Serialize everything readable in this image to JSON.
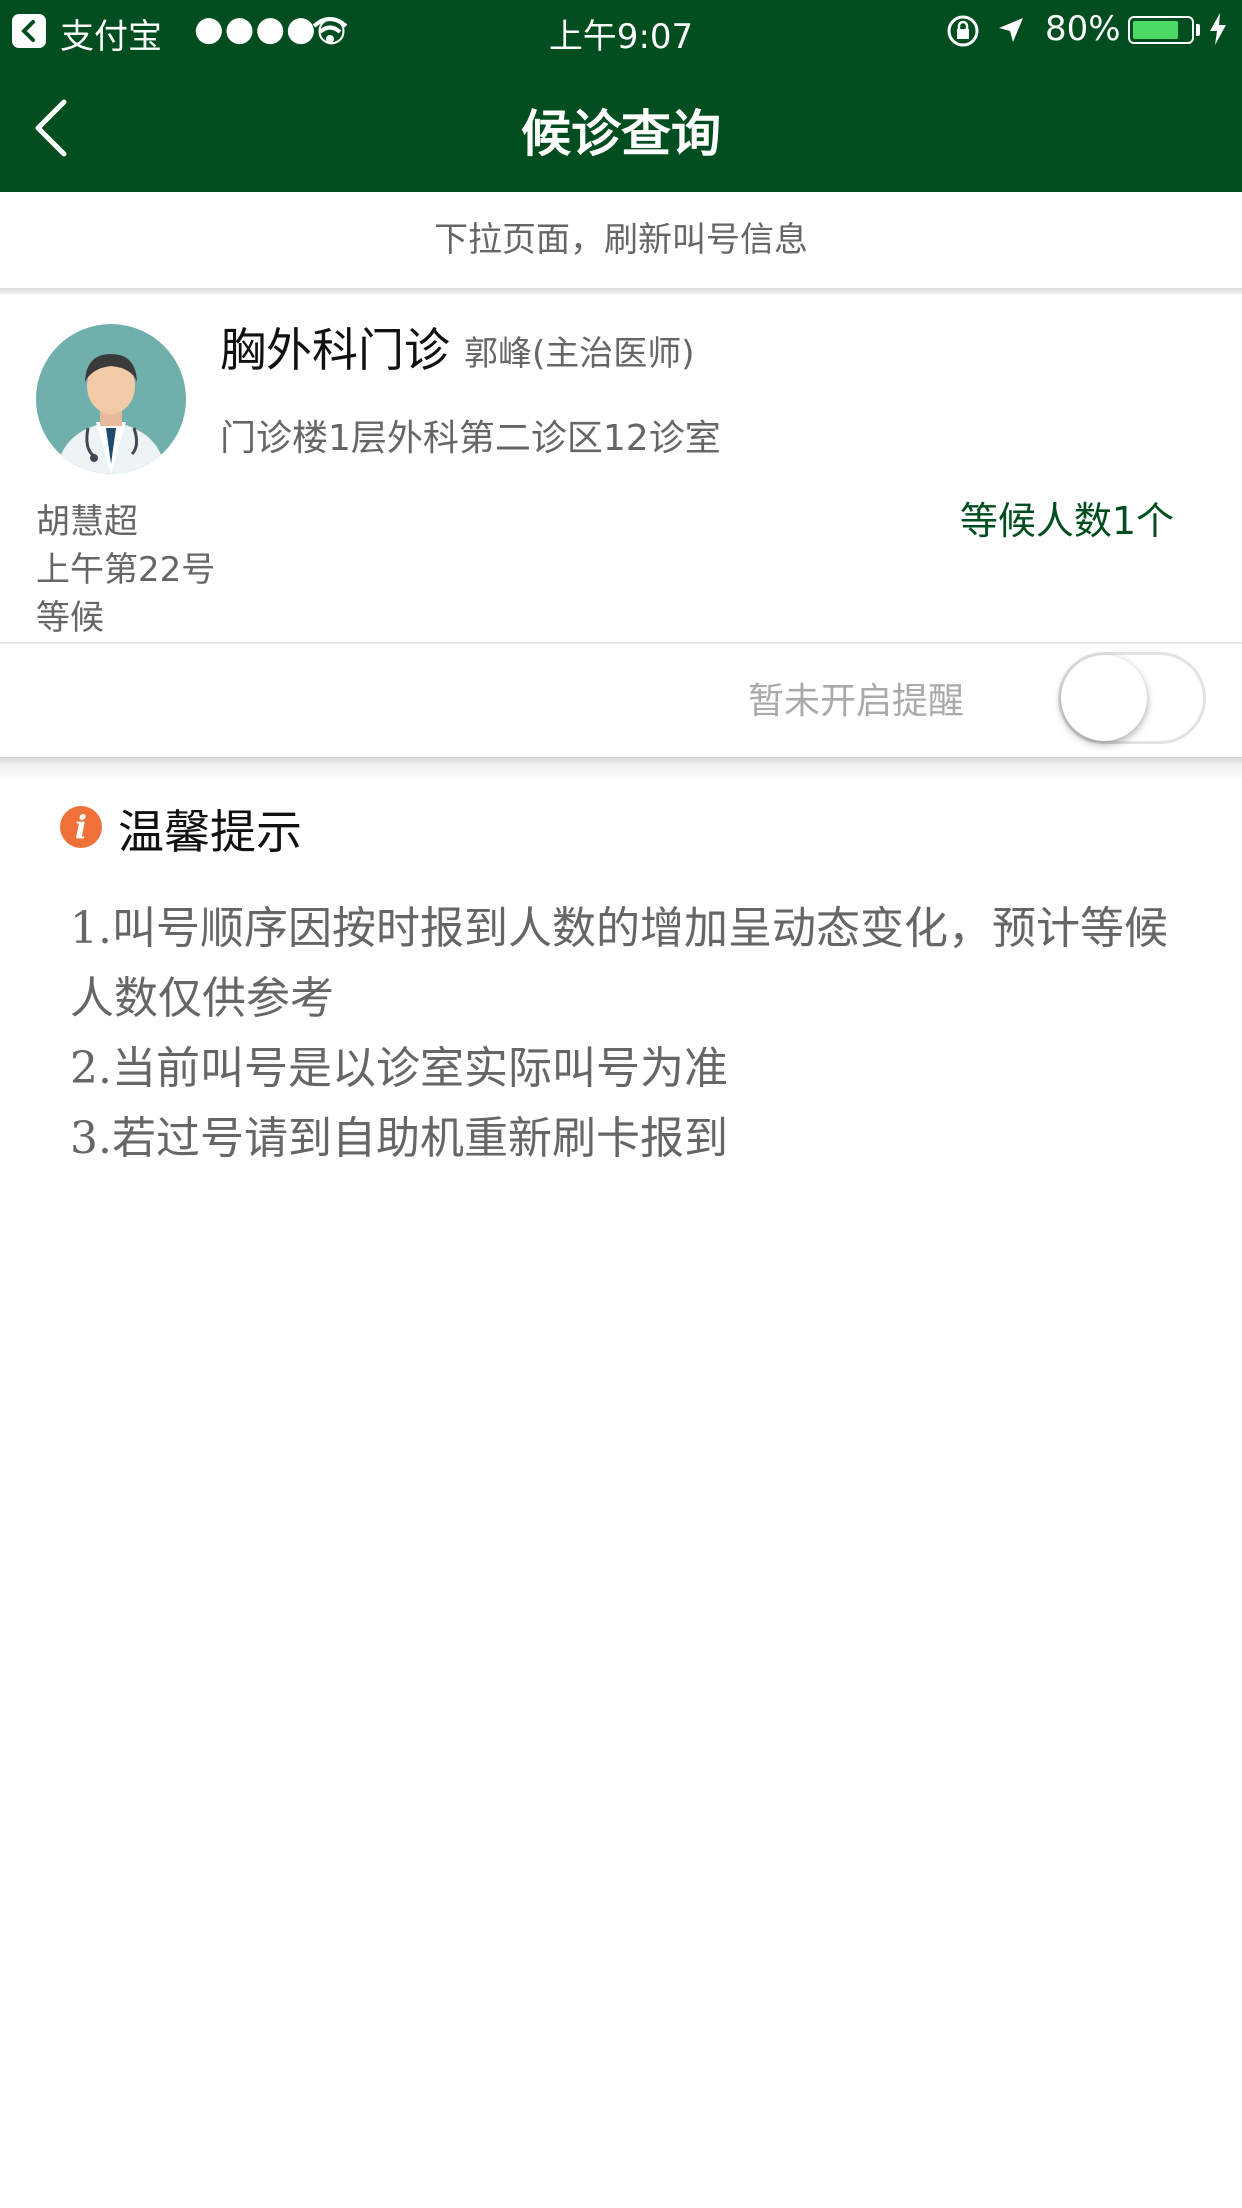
{
  "status_bar": {
    "app_name": "支付宝",
    "signal": "●●●●○",
    "time": "上午9:07",
    "battery_percent": "80%",
    "battery_level": 0.8
  },
  "nav": {
    "title": "候诊查询"
  },
  "refresh_hint": "下拉页面，刷新叫号信息",
  "card": {
    "department": "胸外科门诊",
    "doctor": "郭峰(主治医师)",
    "location": "门诊楼1层外科第二诊区12诊室",
    "patient_name": "胡慧超",
    "queue_number": "上午第22号",
    "status": "等候",
    "waiting_count": "等候人数1个",
    "reminder_label": "暂未开启提醒",
    "reminder_on": false
  },
  "tips": {
    "title": "温馨提示",
    "items": [
      "1.叫号顺序因按时报到人数的增加呈动态变化，预计等候人数仅供参考",
      "2.当前叫号是以诊室实际叫号为准",
      "3.若过号请到自助机重新刷卡报到"
    ]
  },
  "colors": {
    "primary": "#004d1f",
    "accent_icon": "#f0703a",
    "battery": "#4cd964"
  }
}
